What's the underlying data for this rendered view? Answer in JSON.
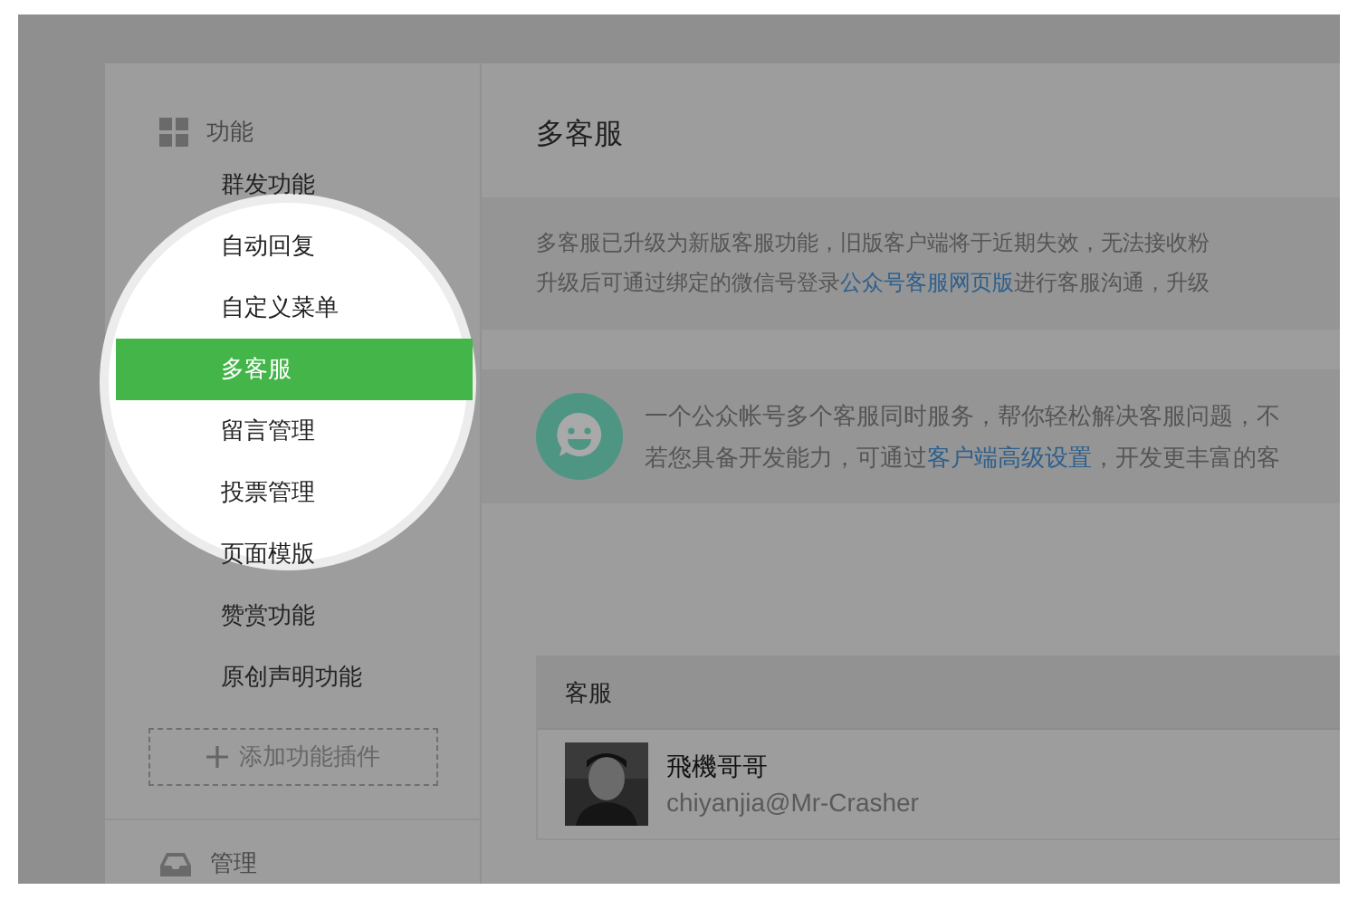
{
  "sidebar": {
    "section_title": "功能",
    "items": [
      {
        "label": "群发功能",
        "selected": false
      },
      {
        "label": "自动回复",
        "selected": false
      },
      {
        "label": "自定义菜单",
        "selected": false
      },
      {
        "label": "多客服",
        "selected": true
      },
      {
        "label": "留言管理",
        "selected": false
      },
      {
        "label": "投票管理",
        "selected": false
      },
      {
        "label": "页面模版",
        "selected": false
      },
      {
        "label": "赞赏功能",
        "selected": false
      },
      {
        "label": "原创声明功能",
        "selected": false
      }
    ],
    "add_plugin_button": "添加功能插件",
    "second_section_title": "管理"
  },
  "main": {
    "title": "多客服",
    "notice": [
      [
        {
          "kind": "text",
          "text": "多客服已升级为新版客服功能，旧版客户端将于近期失效，无法接收粉"
        }
      ],
      [
        {
          "kind": "text",
          "text": "升级后可通过绑定的微信号登录"
        },
        {
          "kind": "link",
          "text": "公众号客服网页版"
        },
        {
          "kind": "text",
          "text": "进行客服沟通，升级"
        }
      ]
    ],
    "intro": [
      [
        {
          "kind": "text",
          "text": "一个公众帐号多个客服同时服务，帮你轻松解决客服问题，不"
        }
      ],
      [
        {
          "kind": "text",
          "text": "若您具备开发能力，可通过"
        },
        {
          "kind": "link",
          "text": "客户端高级设置"
        },
        {
          "kind": "text",
          "text": "，开发更丰富的客"
        }
      ]
    ],
    "table": {
      "columns": [
        "客服"
      ],
      "rows": [
        {
          "name": "飛機哥哥",
          "account": "chiyanjia@Mr-Crasher"
        }
      ]
    }
  }
}
